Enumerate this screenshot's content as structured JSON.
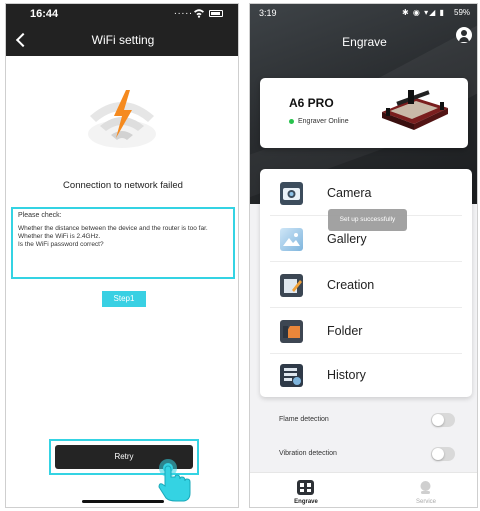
{
  "left": {
    "status": {
      "time": "16:44",
      "dots": "....."
    },
    "nav": {
      "title": "WiFi setting"
    },
    "fail_message": "Connection to network failed",
    "check": {
      "heading": "Please check:",
      "lines": [
        "Whether the distance between the device and the router is too far.",
        "Whether the WiFi is 2.4GHz.",
        "Is the WiFi password correct?"
      ]
    },
    "step_label": "Step1",
    "retry_label": "Retry",
    "colors": {
      "accent": "#34d3e3",
      "bolt": "#f58a1f"
    }
  },
  "right": {
    "status": {
      "time": "3:19",
      "icons": "✱ ◉ ▾◢ ▮",
      "battery": "59%"
    },
    "title": "Engrave",
    "device": {
      "model": "A6 PRO",
      "status": "Engraver Online"
    },
    "menu": [
      {
        "label": "Camera",
        "icon": "camera-icon"
      },
      {
        "label": "Gallery",
        "icon": "gallery-icon"
      },
      {
        "label": "Creation",
        "icon": "creation-icon"
      },
      {
        "label": "Folder",
        "icon": "folder-icon"
      },
      {
        "label": "History",
        "icon": "history-icon"
      }
    ],
    "toast": "Set up successfully",
    "settings": [
      {
        "label": "Flame detection",
        "enabled": false
      },
      {
        "label": "Vibration detection",
        "enabled": false
      }
    ],
    "tabs": [
      {
        "label": "Engrave",
        "active": true
      },
      {
        "label": "Service",
        "active": false
      }
    ],
    "colors": {
      "online": "#27c24c",
      "hero": "#2a2d30"
    }
  }
}
